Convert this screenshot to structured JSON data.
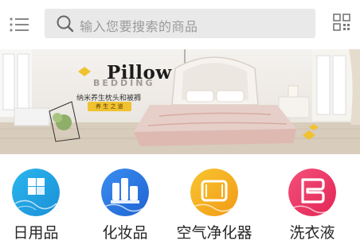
{
  "header": {
    "menu_icon": "list-menu-icon",
    "search": {
      "placeholder": "输入您要搜索的商品",
      "icon": "search-icon"
    },
    "scan_icon": "qr-code-icon"
  },
  "banner": {
    "title": "Pillow",
    "subtitle": "BEDDING",
    "tagline": "纳米养生枕头和被褥",
    "pill": "养 生 之 道",
    "accent_color": "#f0c231"
  },
  "categories": [
    {
      "label": "日用品",
      "icon": "daily-goods-icon",
      "colors": [
        "#2bb7ee",
        "#1a8fd6"
      ]
    },
    {
      "label": "化妆品",
      "icon": "cosmetics-icon",
      "colors": [
        "#3a8ef0",
        "#1f63d2"
      ]
    },
    {
      "label": "空气净化器",
      "icon": "air-purifier-icon",
      "colors": [
        "#f8c530",
        "#f29a16"
      ]
    },
    {
      "label": "洗衣液",
      "icon": "laundry-detergent-icon",
      "colors": [
        "#f4507a",
        "#e22656"
      ]
    }
  ]
}
